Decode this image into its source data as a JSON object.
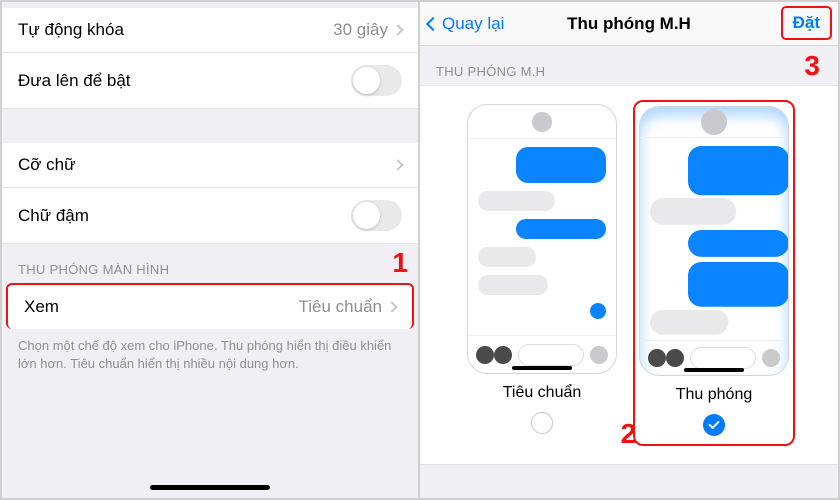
{
  "left": {
    "rows": {
      "auto_lock": {
        "label": "Tự động khóa",
        "value": "30 giây"
      },
      "raise_to_wake": {
        "label": "Đưa lên để bật"
      },
      "text_size": {
        "label": "Cỡ chữ"
      },
      "bold_text": {
        "label": "Chữ đậm"
      }
    },
    "section_header": "THU PHÓNG MÀN HÌNH",
    "view_row": {
      "label": "Xem",
      "value": "Tiêu chuẩn"
    },
    "footer": "Chọn một chế độ xem cho iPhone. Thu phóng hiển thị điều khiển lớn hơn. Tiêu chuẩn hiển thị nhiều nội dung hơn."
  },
  "right": {
    "nav": {
      "back": "Quay lại",
      "title": "Thu phóng M.H",
      "action": "Đặt"
    },
    "section_header": "THU PHÓNG M.H",
    "options": {
      "standard": {
        "label": "Tiêu chuẩn",
        "selected": false
      },
      "zoomed": {
        "label": "Thu phóng",
        "selected": true
      }
    }
  },
  "annotations": {
    "n1": "1",
    "n2": "2",
    "n3": "3"
  }
}
